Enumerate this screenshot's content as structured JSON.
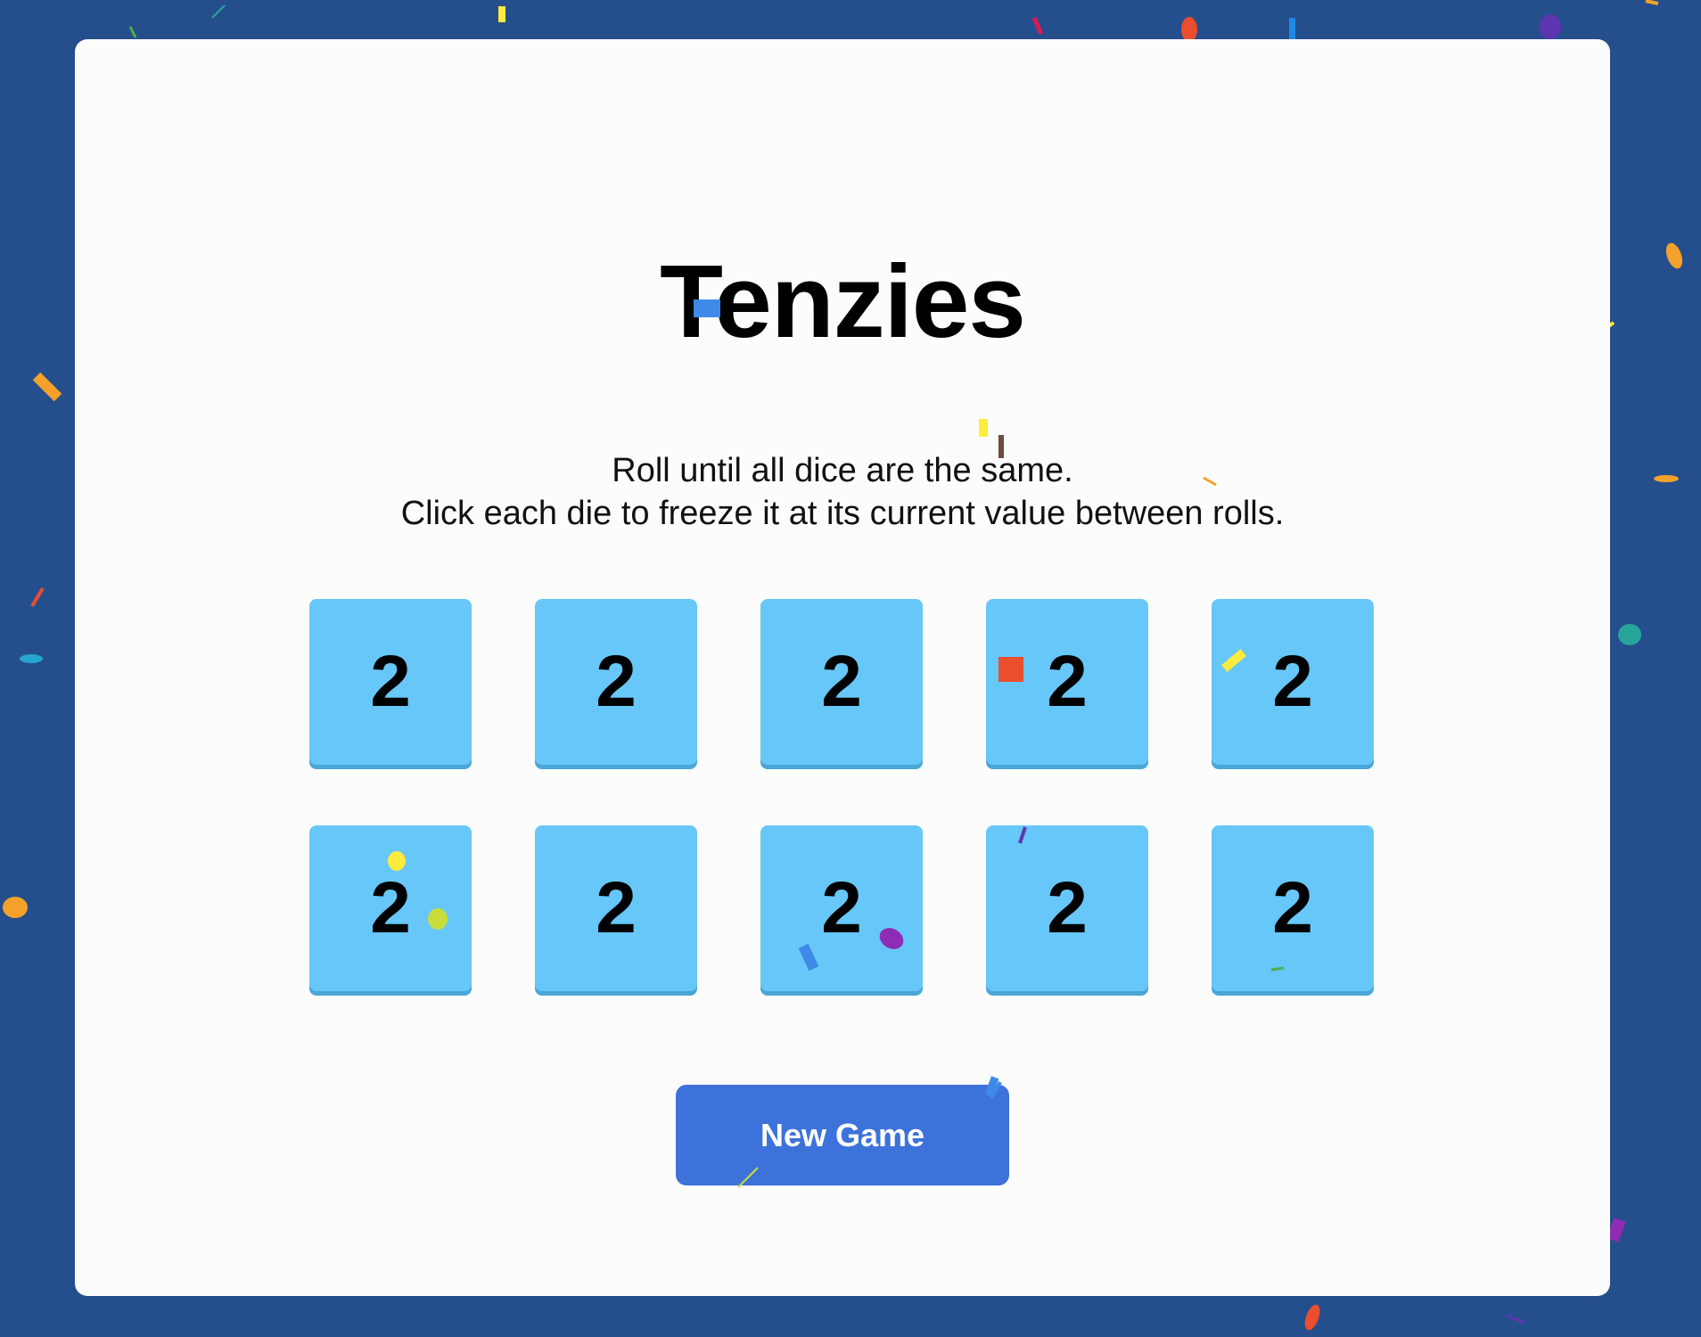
{
  "game": {
    "title": "Tenzies",
    "instructions_line1": "Roll until all dice are the same.",
    "instructions_line2": "Click each die to freeze it at its current value between rolls.",
    "dice": [
      "2",
      "2",
      "2",
      "2",
      "2",
      "2",
      "2",
      "2",
      "2",
      "2"
    ],
    "button_label": "New Game"
  },
  "colors": {
    "background": "#254e8c",
    "board": "#fcfcfc",
    "die": "#67c7f8",
    "button": "#3c72da",
    "confetti": [
      "#e94e2f",
      "#f4a12b",
      "#3e8ae6",
      "#8e2cb5",
      "#d81b4f",
      "#c8dd3c",
      "#4caf50",
      "#6d4c41",
      "#1e88e5",
      "#26a69a",
      "#5e35b1",
      "#ffeb3b",
      "#8bc34a",
      "#f06292"
    ]
  },
  "effects": {
    "confetti": true
  }
}
